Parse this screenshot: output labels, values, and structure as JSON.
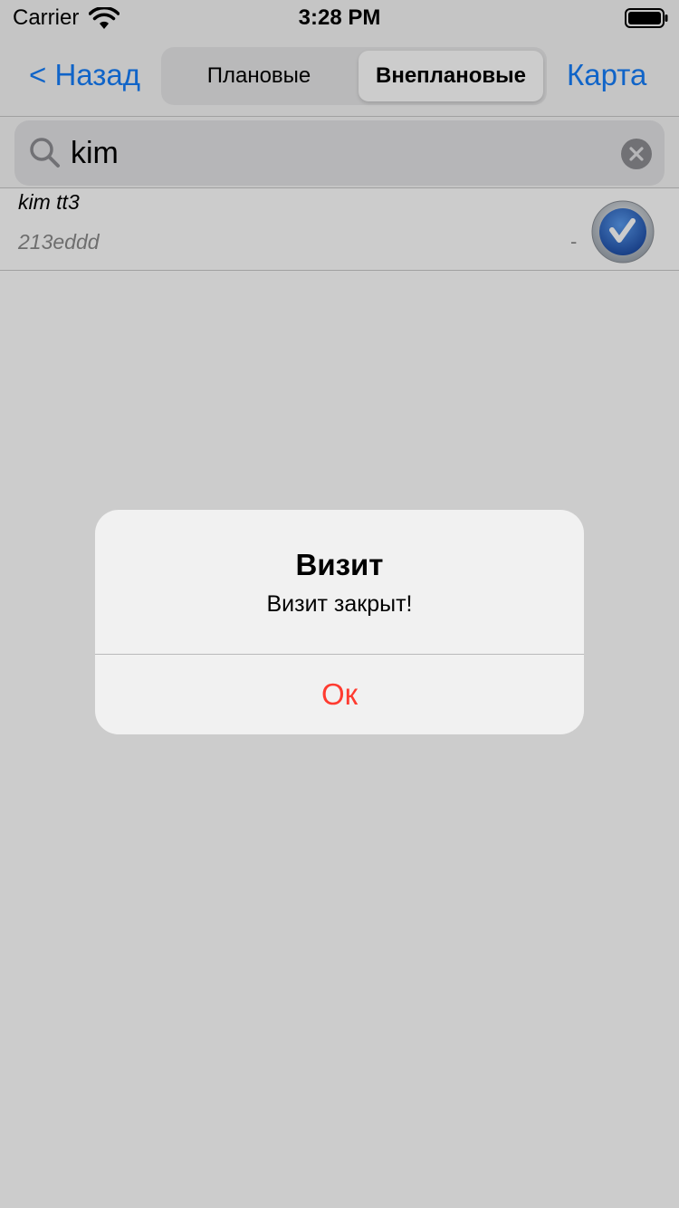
{
  "status_bar": {
    "carrier": "Carrier",
    "time": "3:28 PM"
  },
  "nav": {
    "back_label": "< Назад",
    "segments": [
      "Плановые",
      "Внеплановые"
    ],
    "selected_segment": "Внеплановые",
    "map_label": "Карта"
  },
  "search": {
    "value": "kim"
  },
  "list": {
    "items": [
      {
        "title": "kim tt3",
        "subtitle": "213eddd",
        "trailing": "-"
      }
    ]
  },
  "alert": {
    "title": "Визит",
    "message": "Визит закрыт!",
    "ok_label": "Ок"
  },
  "colors": {
    "accent": "#147efb",
    "destructive": "#ff3b30"
  }
}
